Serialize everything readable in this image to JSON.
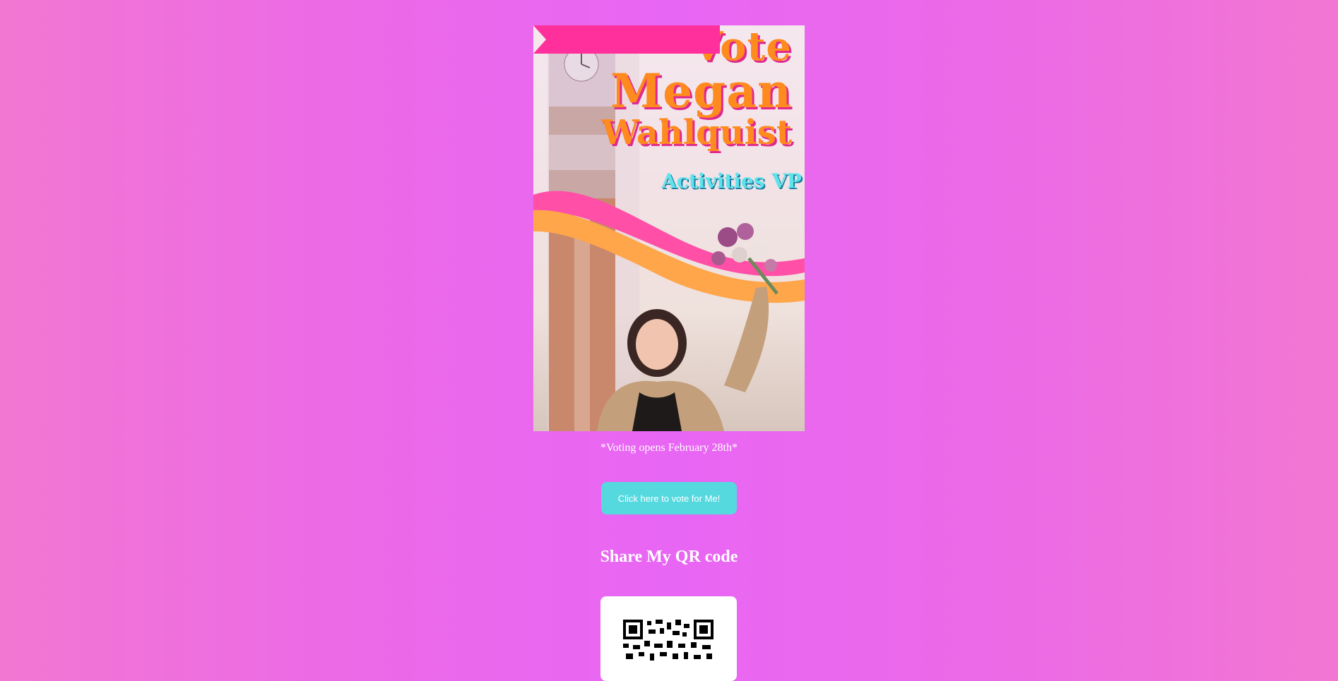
{
  "poster": {
    "title_line1": "Vote",
    "title_line2": "Megan",
    "title_line3": "Wahlquist",
    "role": "Activities VP",
    "colors": {
      "orange": "#ff8a1e",
      "pink": "#e0288f",
      "cyan": "#5ce3ec"
    }
  },
  "note": "*Voting opens February 28th*",
  "vote_button": {
    "label": "Click here to vote for Me!"
  },
  "qr": {
    "heading": "Share My QR code",
    "icon": "qr-code-icon"
  },
  "colors": {
    "button": "#55d9df",
    "background": "#e866f4"
  }
}
